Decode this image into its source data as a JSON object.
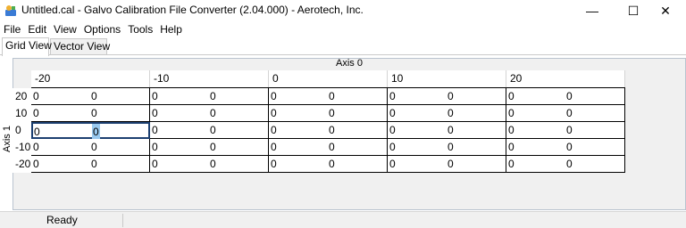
{
  "window": {
    "title": "Untitled.cal - Galvo Calibration File Converter (2.04.000) - Aerotech, Inc.",
    "minimize_glyph": "—",
    "maximize_glyph": "☐",
    "close_glyph": "✕"
  },
  "menu": [
    "File",
    "Edit",
    "View",
    "Options",
    "Tools",
    "Help"
  ],
  "tabs": [
    {
      "label": "Grid View",
      "active": true
    },
    {
      "label": "Vector View",
      "active": false
    }
  ],
  "grid": {
    "axis0_label": "Axis 0",
    "axis1_label": "Axis 1",
    "columns": [
      "-20",
      "-10",
      "0",
      "10",
      "20"
    ],
    "rows": [
      {
        "label": "20",
        "values": [
          [
            "0",
            "0"
          ],
          [
            "0",
            "0"
          ],
          [
            "0",
            "0"
          ],
          [
            "0",
            "0"
          ],
          [
            "0",
            "0"
          ]
        ]
      },
      {
        "label": "10",
        "values": [
          [
            "0",
            "0"
          ],
          [
            "0",
            "0"
          ],
          [
            "0",
            "0"
          ],
          [
            "0",
            "0"
          ],
          [
            "0",
            "0"
          ]
        ]
      },
      {
        "label": "0",
        "values": [
          [
            "0",
            "0"
          ],
          [
            "0",
            "0"
          ],
          [
            "0",
            "0"
          ],
          [
            "0",
            "0"
          ],
          [
            "0",
            "0"
          ]
        ]
      },
      {
        "label": "-10",
        "values": [
          [
            "0",
            "0"
          ],
          [
            "0",
            "0"
          ],
          [
            "0",
            "0"
          ],
          [
            "0",
            "0"
          ],
          [
            "0",
            "0"
          ]
        ]
      },
      {
        "label": "-20",
        "values": [
          [
            "0",
            "0"
          ],
          [
            "0",
            "0"
          ],
          [
            "0",
            "0"
          ],
          [
            "0",
            "0"
          ],
          [
            "0",
            "0"
          ]
        ]
      }
    ],
    "selected_cell": {
      "row": 2,
      "col": 0
    }
  },
  "status": {
    "text": "Ready"
  },
  "colors": {
    "selection": "#99c9ef",
    "selected_border": "#1c3f70"
  }
}
